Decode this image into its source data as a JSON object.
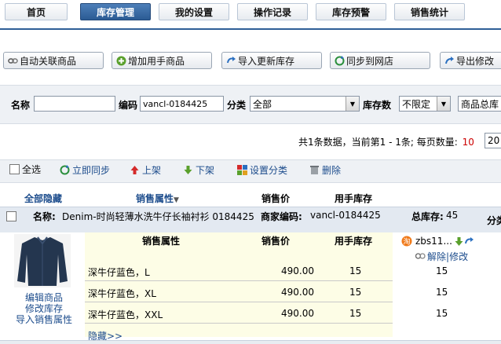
{
  "nav": {
    "tabs": [
      {
        "label": "首页"
      },
      {
        "label": "库存管理"
      },
      {
        "label": "我的设置"
      },
      {
        "label": "操作记录"
      },
      {
        "label": "库存预警"
      },
      {
        "label": "销售统计"
      }
    ],
    "active_index": 1
  },
  "actions": {
    "auto_link": "自动关联商品",
    "add_used": "增加用手商品",
    "import_update": "导入更新库存",
    "sync_store": "同步到网店",
    "export_modify": "导出修改"
  },
  "search": {
    "name_label": "名称",
    "name_value": "",
    "code_label": "编码",
    "code_value": "vancl-0184425",
    "category_label": "分类",
    "category_value": "全部",
    "stock_label": "库存数",
    "stock_value": "不限定",
    "total_select": "商品总库"
  },
  "pagination": {
    "summary": "共1条数据，当前第1 - 1条; 每页数量:",
    "per_page_current": "10",
    "per_page_box": "20"
  },
  "toolbar": {
    "select_all": "全选",
    "sync_now": "立即同步",
    "list_up": "上架",
    "list_down": "下架",
    "set_category": "设置分类",
    "delete": "删除"
  },
  "table": {
    "col_hide_all": "全部隐藏",
    "col_attr": "销售属性",
    "col_price": "销售价",
    "col_stock": "用手库存",
    "product": {
      "name_label": "名称:",
      "name": "Denim-时尚轻薄水洗牛仔长袖衬衫 0184425",
      "code_label": "商家编码:",
      "code": "vancl-0184425",
      "total_label": "总库存:",
      "total": "45",
      "category_trunc": "分类"
    },
    "detail_headers": {
      "attr": "销售属性",
      "price": "销售价",
      "stock": "用手库存"
    },
    "rows": [
      {
        "attr": "深牛仔蓝色，L",
        "price": "490.00",
        "stock": "15",
        "shop_stock": "15"
      },
      {
        "attr": "深牛仔蓝色，XL",
        "price": "490.00",
        "stock": "15",
        "shop_stock": "15"
      },
      {
        "attr": "深牛仔蓝色，XXL",
        "price": "490.00",
        "stock": "15",
        "shop_stock": "15"
      }
    ],
    "shop": {
      "name": "zbs11...",
      "unlink": "解除",
      "modify": "修改"
    },
    "links": {
      "edit": "编辑商品",
      "modify_stock": "修改库存",
      "import_attr": "导入销售属性",
      "hide": "隐藏>>"
    }
  },
  "colors": {
    "nav_active": "#2b5b94",
    "link": "#1c4c8c",
    "panel": "#eef1f5",
    "detail_bg": "#fdfde6",
    "page_current": "#cc0000"
  }
}
